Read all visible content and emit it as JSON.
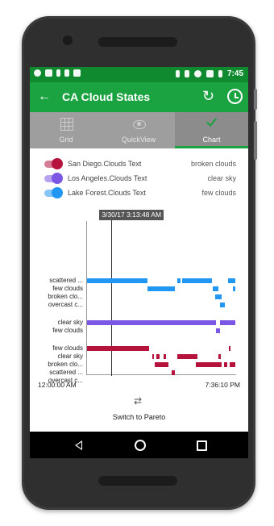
{
  "status_bar": {
    "time": "7:45",
    "left_icons": [
      "skype-icon",
      "image-icon",
      "download-icon",
      "usb-icon",
      "briefcase-icon"
    ],
    "right_icons": [
      "bluetooth-icon",
      "vibrate-icon",
      "wifi-icon",
      "signal-icon",
      "battery-icon"
    ]
  },
  "app_bar": {
    "title": "CA Cloud States",
    "back_icon": "arrow-back-icon",
    "actions": [
      "refresh-icon",
      "clock-icon"
    ]
  },
  "tabs": [
    {
      "label": "Grid",
      "icon": "grid-icon",
      "active": false
    },
    {
      "label": "QuickView",
      "icon": "eye-icon",
      "active": false
    },
    {
      "label": "Chart",
      "icon": "check-icon",
      "active": true
    }
  ],
  "legend": [
    {
      "name": "San Diego.Clouds Text",
      "value": "broken clouds",
      "color": "#b5123c"
    },
    {
      "name": "Los Angeles.Clouds Text",
      "value": "clear sky",
      "color": "#7b57e4"
    },
    {
      "name": "Lake Forest.Clouds Text",
      "value": "few clouds",
      "color": "#2196f3"
    }
  ],
  "chart_data": {
    "type": "timeline",
    "cursor_label": "3/30/17 3:13:48 AM",
    "x_start": "12:00:00 AM",
    "x_end": "7:36:10 PM",
    "x_range_hours": [
      0,
      19.6028
    ],
    "cursor_hour": 3.23,
    "series": [
      {
        "name": "Lake Forest.Clouds Text",
        "color": "#2196f3",
        "rows": [
          {
            "label": "scattered ...",
            "segments": [
              [
                0.0,
                8.0
              ],
              [
                11.9,
                12.4
              ],
              [
                12.6,
                16.5
              ],
              [
                18.6,
                19.6
              ]
            ]
          },
          {
            "label": "few clouds",
            "segments": [
              [
                8.0,
                11.6
              ],
              [
                16.6,
                17.4
              ],
              [
                19.3,
                19.6
              ]
            ]
          },
          {
            "label": "broken clo...",
            "segments": [
              [
                16.9,
                17.8
              ]
            ]
          },
          {
            "label": "overcast c...",
            "segments": [
              [
                17.6,
                18.2
              ]
            ]
          }
        ]
      },
      {
        "name": "Los Angeles.Clouds Text",
        "color": "#7b57e4",
        "rows": [
          {
            "label": "clear sky",
            "segments": [
              [
                0.0,
                17.0
              ],
              [
                17.6,
                19.6
              ]
            ]
          },
          {
            "label": "few clouds",
            "segments": [
              [
                17.0,
                17.6
              ]
            ]
          }
        ]
      },
      {
        "name": "San Diego.Clouds Text",
        "color": "#b5123c",
        "rows": [
          {
            "label": "few clouds",
            "segments": [
              [
                0.0,
                8.2
              ],
              [
                18.7,
                18.95
              ]
            ]
          },
          {
            "label": "clear sky",
            "segments": [
              [
                8.6,
                8.85
              ],
              [
                9.2,
                9.6
              ],
              [
                10.1,
                10.45
              ],
              [
                11.9,
                14.6
              ],
              [
                17.4,
                17.7
              ]
            ]
          },
          {
            "label": "broken clo...",
            "segments": [
              [
                9.0,
                10.8
              ],
              [
                14.4,
                17.8
              ],
              [
                18.1,
                18.5
              ],
              [
                18.9,
                19.6
              ]
            ]
          },
          {
            "label": "scattered ...",
            "segments": [
              [
                11.2,
                11.6
              ]
            ]
          },
          {
            "label": "overcast c...",
            "segments": []
          }
        ]
      }
    ]
  },
  "footer": {
    "pareto_icon": "swap-arrows-icon",
    "pareto_label": "Switch to Pareto"
  },
  "nav_bar": {
    "icons": [
      "nav-back-icon",
      "nav-home-icon",
      "nav-recents-icon"
    ]
  }
}
